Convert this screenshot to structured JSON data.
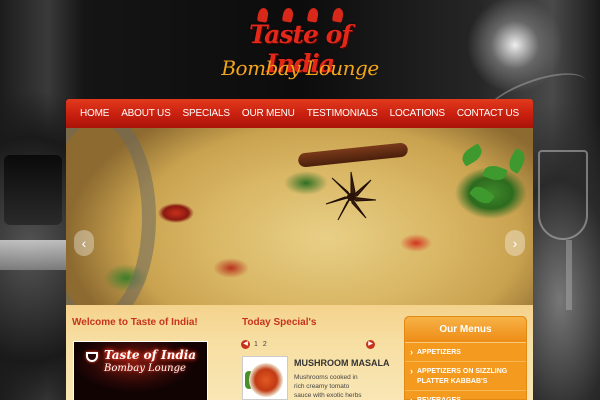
{
  "logo": {
    "main": "Taste of India",
    "sub": "Bombay Lounge"
  },
  "nav": {
    "items": [
      "HOME",
      "ABOUT US",
      "SPECIALS",
      "OUR MENU",
      "TESTIMONIALS",
      "LOCATIONS",
      "CONTACT US"
    ]
  },
  "slider": {
    "prev_icon": "chevron-left-icon",
    "next_icon": "chevron-right-icon"
  },
  "welcome": {
    "title": "Welcome to Taste of India!",
    "image_sign": {
      "main": "Taste of India",
      "sub": "Bombay Lounge"
    }
  },
  "specials": {
    "title": "Today Special's",
    "pages": [
      "1",
      "2"
    ],
    "item_name": "MUSHROOM MASALA",
    "item_desc": "Mushrooms cooked in rich creamy tomato sauce with exotic herbs and"
  },
  "menu": {
    "title": "Our Menus",
    "items": [
      "APPETIZERS",
      "APPETIZERS ON SIZZLING PLATTER KABBAB'S",
      "BEVERAGES"
    ]
  },
  "colors": {
    "nav_red": "#c81f0f",
    "title_red": "#c7341c",
    "menu_orange": "#f39a1f",
    "panel_cream": "#f7dfa3"
  }
}
